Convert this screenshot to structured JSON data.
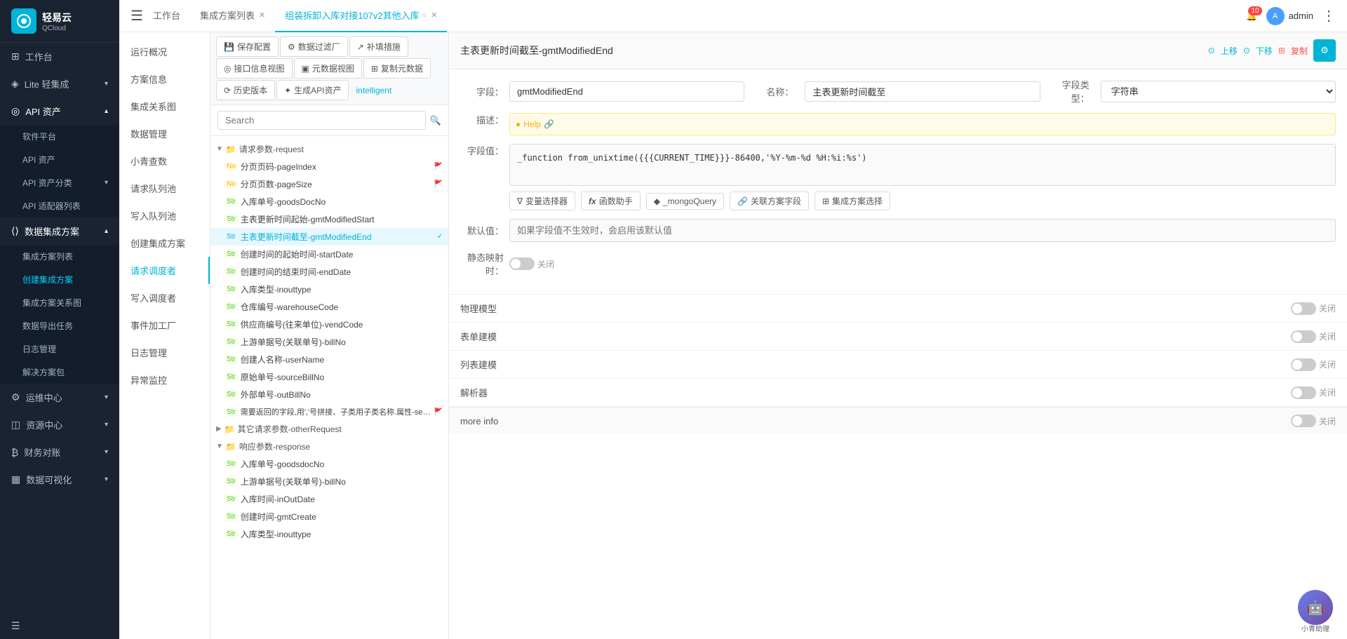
{
  "app": {
    "logo_text": "轻易云",
    "logo_sub": "QCloud",
    "menu_icon": "☰"
  },
  "sidebar": {
    "items": [
      {
        "id": "workspace",
        "label": "工作台",
        "icon": "⊞",
        "arrow": ""
      },
      {
        "id": "lite",
        "label": "Lite 轻集成",
        "icon": "◈",
        "arrow": "▾"
      },
      {
        "id": "api",
        "label": "API 资产",
        "icon": "◎",
        "arrow": "▾",
        "active": true
      },
      {
        "id": "software",
        "label": "软件平台",
        "sub": true
      },
      {
        "id": "api-assets",
        "label": "API 资产",
        "sub": true
      },
      {
        "id": "api-classify",
        "label": "API 资产分类",
        "sub": true,
        "arrow": "▾"
      },
      {
        "id": "api-adapters",
        "label": "API 适配器列表",
        "sub": true
      },
      {
        "id": "data-integration",
        "label": "数据集成方案",
        "icon": "⟨⟩",
        "arrow": "▾",
        "active2": true
      },
      {
        "id": "integration-list",
        "label": "集成方案列表",
        "sub": true
      },
      {
        "id": "create-integration",
        "label": "创建集成方案",
        "sub": true,
        "active": true
      },
      {
        "id": "integration-graph",
        "label": "集成方案关系图",
        "sub": true
      },
      {
        "id": "data-export",
        "label": "数据导出任务",
        "sub": true
      },
      {
        "id": "log-management",
        "label": "日志管理",
        "sub": true
      },
      {
        "id": "solution-package",
        "label": "解决方案包",
        "sub": true
      },
      {
        "id": "ops",
        "label": "运维中心",
        "icon": "⚙",
        "arrow": "▾"
      },
      {
        "id": "resources",
        "label": "资源中心",
        "icon": "◫",
        "arrow": "▾"
      },
      {
        "id": "finance",
        "label": "财务对账",
        "icon": "₿",
        "arrow": "▾"
      },
      {
        "id": "dataviz",
        "label": "数据可视化",
        "icon": "▦",
        "arrow": "▾"
      }
    ]
  },
  "topbar": {
    "menu_icon": "☰",
    "tabs": [
      {
        "id": "workspace",
        "label": "工作台",
        "active": false
      },
      {
        "id": "integration-list",
        "label": "集成方案列表",
        "active": false,
        "closable": true
      },
      {
        "id": "integration-detail",
        "label": "组装拆卸入库对接107v2其他入库",
        "active": true,
        "closable": true
      }
    ],
    "more_icon": "⋮",
    "notification_count": "10",
    "admin_label": "admin"
  },
  "left_nav": {
    "items": [
      {
        "id": "overview",
        "label": "运行概况"
      },
      {
        "id": "solution-info",
        "label": "方案信息",
        "active": true
      },
      {
        "id": "integration-graph",
        "label": "集成关系图"
      },
      {
        "id": "data-management",
        "label": "数据管理"
      },
      {
        "id": "xiao-qing",
        "label": "小青查数"
      },
      {
        "id": "request-queue",
        "label": "请求队列池"
      },
      {
        "id": "write-queue",
        "label": "写入队列池"
      },
      {
        "id": "create-integration",
        "label": "创建集成方案"
      },
      {
        "id": "request-debugger",
        "label": "请求调度者",
        "active2": true
      },
      {
        "id": "write-debugger",
        "label": "写入调度者"
      },
      {
        "id": "event-factory",
        "label": "事件加工厂"
      },
      {
        "id": "log-management",
        "label": "日志管理"
      },
      {
        "id": "exception-monitor",
        "label": "异常监控"
      }
    ]
  },
  "toolbar": {
    "buttons": [
      {
        "id": "save-config",
        "label": "保存配置",
        "icon": "💾"
      },
      {
        "id": "data-filter",
        "label": "数据过滤厂",
        "icon": "⚙"
      },
      {
        "id": "補填措施",
        "label": "补填措施",
        "icon": "↗"
      },
      {
        "id": "api-info",
        "label": "接口信息视图",
        "icon": "◎"
      },
      {
        "id": "meta-data",
        "label": "元数据视图",
        "icon": "▣"
      },
      {
        "id": "copy-data",
        "label": "复制元数据",
        "icon": "⊞"
      },
      {
        "id": "history",
        "label": "历史版本",
        "icon": "⟳"
      },
      {
        "id": "gen-api",
        "label": "生成API资产",
        "icon": "✦"
      },
      {
        "id": "intelligent",
        "label": "intelligent"
      }
    ]
  },
  "search": {
    "placeholder": "Search"
  },
  "tree": {
    "items": [
      {
        "id": "request-params",
        "type": "folder",
        "label": "请求参数-request",
        "indent": 0,
        "collapsed": false,
        "arrow": "▼"
      },
      {
        "id": "pageIndex",
        "type": "No",
        "label": "分页页码-pageIndex",
        "indent": 1,
        "flag": true
      },
      {
        "id": "pageSize",
        "type": "No",
        "label": "分页页数-pageSize",
        "indent": 1,
        "flag": true
      },
      {
        "id": "goodsDocNo",
        "type": "Str",
        "label": "入库单号-goodsDocNo",
        "indent": 1
      },
      {
        "id": "gmtModifiedStart",
        "type": "Str",
        "label": "主表更新时间起始-gmtModifiedStart",
        "indent": 1
      },
      {
        "id": "gmtModifiedEnd",
        "type": "Str",
        "label": "主表更新时间截至-gmtModifiedEnd",
        "indent": 1,
        "selected": true
      },
      {
        "id": "startDate",
        "type": "Str",
        "label": "创建时间的起始时间-startDate",
        "indent": 1
      },
      {
        "id": "endDate",
        "type": "Str",
        "label": "创建时间的结束时间-endDate",
        "indent": 1
      },
      {
        "id": "inouttype",
        "type": "Str",
        "label": "入库类型-inouttype",
        "indent": 1
      },
      {
        "id": "warehouseCode",
        "type": "Str",
        "label": "仓库编号-warehouseCode",
        "indent": 1
      },
      {
        "id": "vendCode",
        "type": "Str",
        "label": "供应商编号(往来单位)-vendCode",
        "indent": 1
      },
      {
        "id": "billNo",
        "type": "Str",
        "label": "上游单据号(关联单号)-billNo",
        "indent": 1
      },
      {
        "id": "userName",
        "type": "Str",
        "label": "创建人名称-userName",
        "indent": 1
      },
      {
        "id": "sourceBillNo",
        "type": "Str",
        "label": "原始单号-sourceBillNo",
        "indent": 1
      },
      {
        "id": "outBillNo",
        "type": "Str",
        "label": "外部单号-outBillNo",
        "indent": 1
      },
      {
        "id": "selelctFields",
        "type": "Str",
        "label": "需要返回的字段,用','号拼接、子类用子类名称.属性-selelctFields",
        "indent": 1,
        "flag": true
      },
      {
        "id": "otherRequest",
        "type": "folder",
        "label": "其它请求参数-otherRequest",
        "indent": 0,
        "collapsed": true
      },
      {
        "id": "response",
        "type": "folder",
        "label": "响应参数-response",
        "indent": 0,
        "collapsed": false,
        "arrow": "▼"
      },
      {
        "id": "goodsdocNo",
        "type": "Str",
        "label": "入库单号-goodsdocNo",
        "indent": 1
      },
      {
        "id": "billNo2",
        "type": "Str",
        "label": "上游单据号(关联单号)-billNo",
        "indent": 1
      },
      {
        "id": "inOutDate",
        "type": "Str",
        "label": "入库时间-inOutDate",
        "indent": 1
      },
      {
        "id": "gmtCreate",
        "type": "Str",
        "label": "创建时间-gmtCreate",
        "indent": 1
      },
      {
        "id": "inouttype2",
        "type": "Str",
        "label": "入库类型-inouttype",
        "indent": 1
      }
    ]
  },
  "detail": {
    "title": "主表更新时间截至-gmtModifiedEnd",
    "actions": {
      "up": "上移",
      "down": "下移",
      "copy": "复制"
    },
    "field": {
      "label": "字段：",
      "value": "gmtModifiedEnd",
      "name_label": "名称：",
      "name_value": "主表更新时间截至",
      "type_label": "字段类型：",
      "type_value": "字符串"
    },
    "desc": {
      "label": "描述：",
      "help_text": "Help",
      "link_icon": "🔗"
    },
    "field_value": {
      "label": "字段值：",
      "code": "_function from_unixtime({{{CURRENT_TIME}}}-86400,'%Y-%m-%d %H:%i:%s')"
    },
    "code_actions": [
      {
        "id": "var-selector",
        "label": "变量选择器",
        "icon": "∇"
      },
      {
        "id": "func-helper",
        "label": "函数助手",
        "icon": "fx"
      },
      {
        "id": "mongo-query",
        "label": "_mongoQuery",
        "icon": "◆"
      },
      {
        "id": "relation-field",
        "label": "关联方案字段",
        "icon": "🔗"
      },
      {
        "id": "integration-select",
        "label": "集成方案选择",
        "icon": "⊞"
      }
    ],
    "default_value": {
      "label": "默认值：",
      "placeholder": "如果字段值不生效时，会启用该默认值"
    },
    "static_map": {
      "label": "静态映射时：",
      "state": "关闭"
    },
    "toggles": [
      {
        "id": "physical-model",
        "label": "物理模型",
        "state": "关闭"
      },
      {
        "id": "form-model",
        "label": "表单建模",
        "state": "关闭"
      },
      {
        "id": "list-model",
        "label": "列表建模",
        "state": "关闭"
      },
      {
        "id": "parser",
        "label": "解析器",
        "state": "关闭"
      },
      {
        "id": "more-info",
        "label": "more info",
        "state": "关闭"
      }
    ]
  },
  "float_assistant": {
    "label": "小青助理"
  }
}
